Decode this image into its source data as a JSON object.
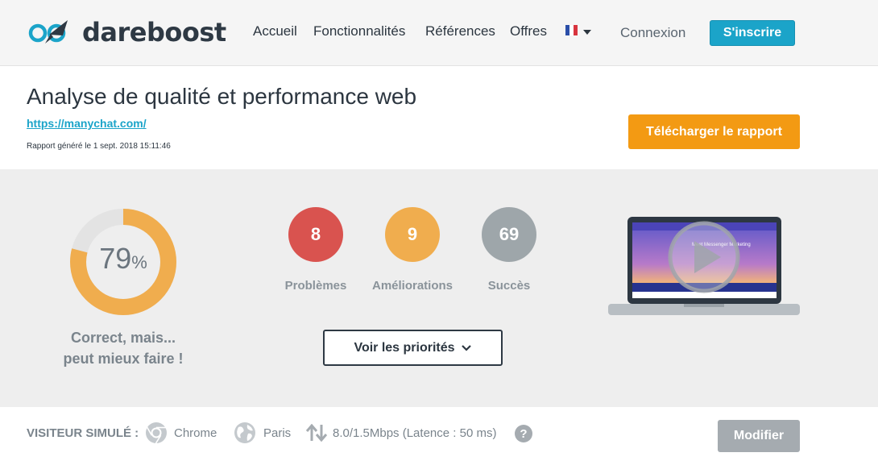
{
  "header": {
    "logo_text": "dareboost",
    "nav": [
      "Accueil",
      "Fonctionnalités",
      "Références",
      "Offres"
    ],
    "language_flag": "fr-flag-icon",
    "login_label": "Connexion",
    "signup_label": "S'inscrire"
  },
  "report": {
    "title": "Analyse de qualité et performance web",
    "url": "https://manychat.com/",
    "generated": "Rapport généré le 1 sept. 2018 15:11:46",
    "download_label": "Télécharger le rapport"
  },
  "score": {
    "value": "79",
    "unit": "%",
    "fraction": 0.79,
    "verdict_line1": "Correct, mais...",
    "verdict_line2": "peut mieux faire !"
  },
  "stats": [
    {
      "count": "8",
      "label": "Problèmes",
      "color": "#d9534f"
    },
    {
      "count": "9",
      "label": "Améliorations",
      "color": "#f0ad4e"
    },
    {
      "count": "69",
      "label": "Succès",
      "color": "#9ea6aa"
    }
  ],
  "priorities_label": "Voir les priorités",
  "preview": {
    "headline": "Meet Messenger Marketing"
  },
  "visitor": {
    "label": "VISITEUR SIMULÉ :",
    "browser": "Chrome",
    "location": "Paris",
    "connection": "8.0/1.5Mbps (Latence : 50 ms)",
    "modify_label": "Modifier"
  },
  "colors": {
    "accent": "#1ba4c9",
    "download": "#f39a13",
    "gauge": "#f0ad4e",
    "dark": "#2e3944"
  }
}
